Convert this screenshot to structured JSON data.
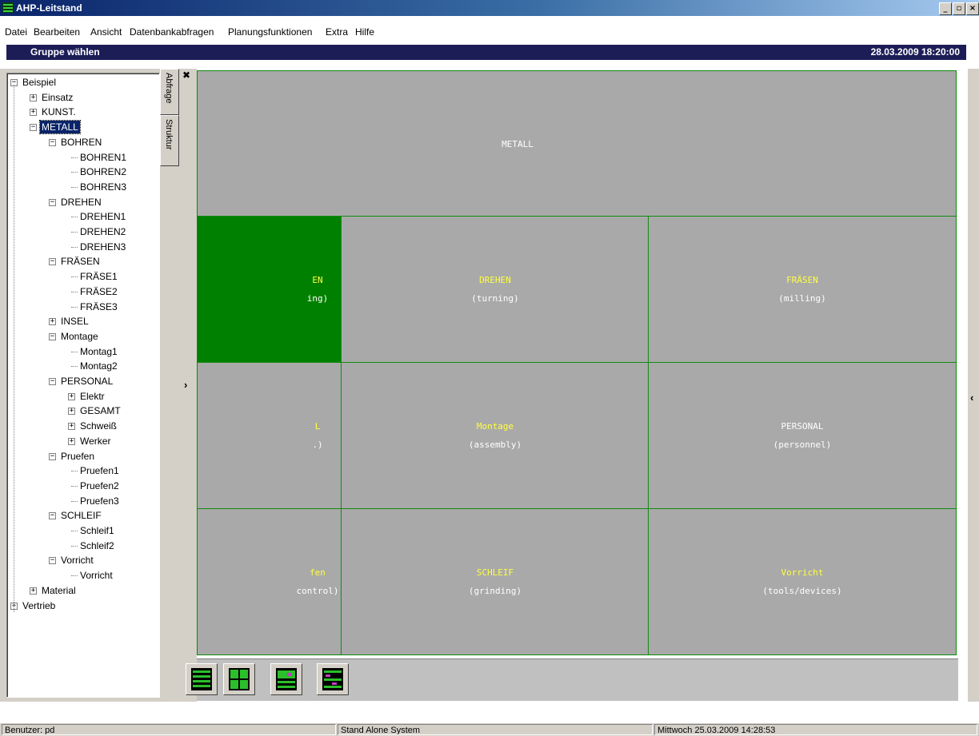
{
  "window": {
    "title": "AHP-Leitstand",
    "controls": {
      "minimize": "_",
      "maximize": "▫",
      "close": "×"
    }
  },
  "menu": [
    "Datei",
    "Bearbeiten",
    "Ansicht",
    "Datenbankabfragen",
    "Planungsfunktionen",
    "Extra",
    "Hilfe"
  ],
  "header": {
    "title": "Gruppe wählen",
    "datetime": "28.03.2009 18:20:00"
  },
  "sidebar": {
    "tabs": {
      "abfrage": "Abfrage",
      "struktur": "Struktur"
    },
    "tree": [
      {
        "label": "Beispiel",
        "level": 0,
        "box": "-"
      },
      {
        "label": "Einsatz",
        "level": 1,
        "box": "+"
      },
      {
        "label": "KUNST.",
        "level": 1,
        "box": "+"
      },
      {
        "label": "METALL",
        "level": 1,
        "box": "-",
        "selected": true
      },
      {
        "label": "BOHREN",
        "level": 2,
        "box": "-"
      },
      {
        "label": "BOHREN1",
        "level": 3
      },
      {
        "label": "BOHREN2",
        "level": 3
      },
      {
        "label": "BOHREN3",
        "level": 3
      },
      {
        "label": "DREHEN",
        "level": 2,
        "box": "-"
      },
      {
        "label": "DREHEN1",
        "level": 3
      },
      {
        "label": "DREHEN2",
        "level": 3
      },
      {
        "label": "DREHEN3",
        "level": 3
      },
      {
        "label": "FRÄSEN",
        "level": 2,
        "box": "-"
      },
      {
        "label": "FRÄSE1",
        "level": 3
      },
      {
        "label": "FRÄSE2",
        "level": 3
      },
      {
        "label": "FRÄSE3",
        "level": 3
      },
      {
        "label": "INSEL",
        "level": 2,
        "box": "+"
      },
      {
        "label": "Montage",
        "level": 2,
        "box": "-"
      },
      {
        "label": "Montag1",
        "level": 3
      },
      {
        "label": "Montag2",
        "level": 3
      },
      {
        "label": "PERSONAL",
        "level": 2,
        "box": "-"
      },
      {
        "label": "Elektr",
        "level": 3,
        "box": "+"
      },
      {
        "label": "GESAMT",
        "level": 3,
        "box": "+"
      },
      {
        "label": "Schweiß",
        "level": 3,
        "box": "+"
      },
      {
        "label": "Werker",
        "level": 3,
        "box": "+"
      },
      {
        "label": "Pruefen",
        "level": 2,
        "box": "-"
      },
      {
        "label": "Pruefen1",
        "level": 3
      },
      {
        "label": "Pruefen2",
        "level": 3
      },
      {
        "label": "Pruefen3",
        "level": 3
      },
      {
        "label": "SCHLEIF",
        "level": 2,
        "box": "-"
      },
      {
        "label": "Schleif1",
        "level": 3
      },
      {
        "label": "Schleif2",
        "level": 3
      },
      {
        "label": "Vorricht",
        "level": 2,
        "box": "-"
      },
      {
        "label": "Vorricht",
        "level": 3
      },
      {
        "label": "Material",
        "level": 1,
        "box": "+"
      },
      {
        "label": "Vertrieb",
        "level": 0,
        "box": "+"
      }
    ],
    "collapse_glyph": "›"
  },
  "grid": {
    "top_label": "METALL",
    "cells": [
      {
        "name": "EN",
        "sub": "ing)",
        "name_color": "yellow",
        "active": true
      },
      {
        "name": "DREHEN",
        "sub": "(turning)",
        "name_color": "yellow"
      },
      {
        "name": "FRÄSEN",
        "sub": "(milling)",
        "name_color": "yellow"
      },
      {
        "name": "L",
        "sub": ".)",
        "name_color": "yellow"
      },
      {
        "name": "Montage",
        "sub": "(assembly)",
        "name_color": "yellow"
      },
      {
        "name": "PERSONAL",
        "sub": "(personnel)",
        "name_color": "white"
      },
      {
        "name": "fen",
        "sub": "control)",
        "name_color": "yellow"
      },
      {
        "name": "SCHLEIF",
        "sub": "(grinding)",
        "name_color": "yellow"
      },
      {
        "name": "Vorricht",
        "sub": "(tools/devices)",
        "name_color": "yellow"
      }
    ]
  },
  "toolbar_icons": [
    "layout-icon-1",
    "layout-icon-2",
    "layout-icon-3",
    "layout-icon-4"
  ],
  "right_glyph": "‹",
  "status": {
    "user": "Benutzer: pd",
    "system": "Stand Alone System",
    "date": "Mittwoch 25.03.2009 14:28:53"
  },
  "colors": {
    "header_bg": "#1c1d57",
    "active_cell": "#008000",
    "grid_bg": "#a9a9a9",
    "label_yellow": "#ffff40"
  }
}
